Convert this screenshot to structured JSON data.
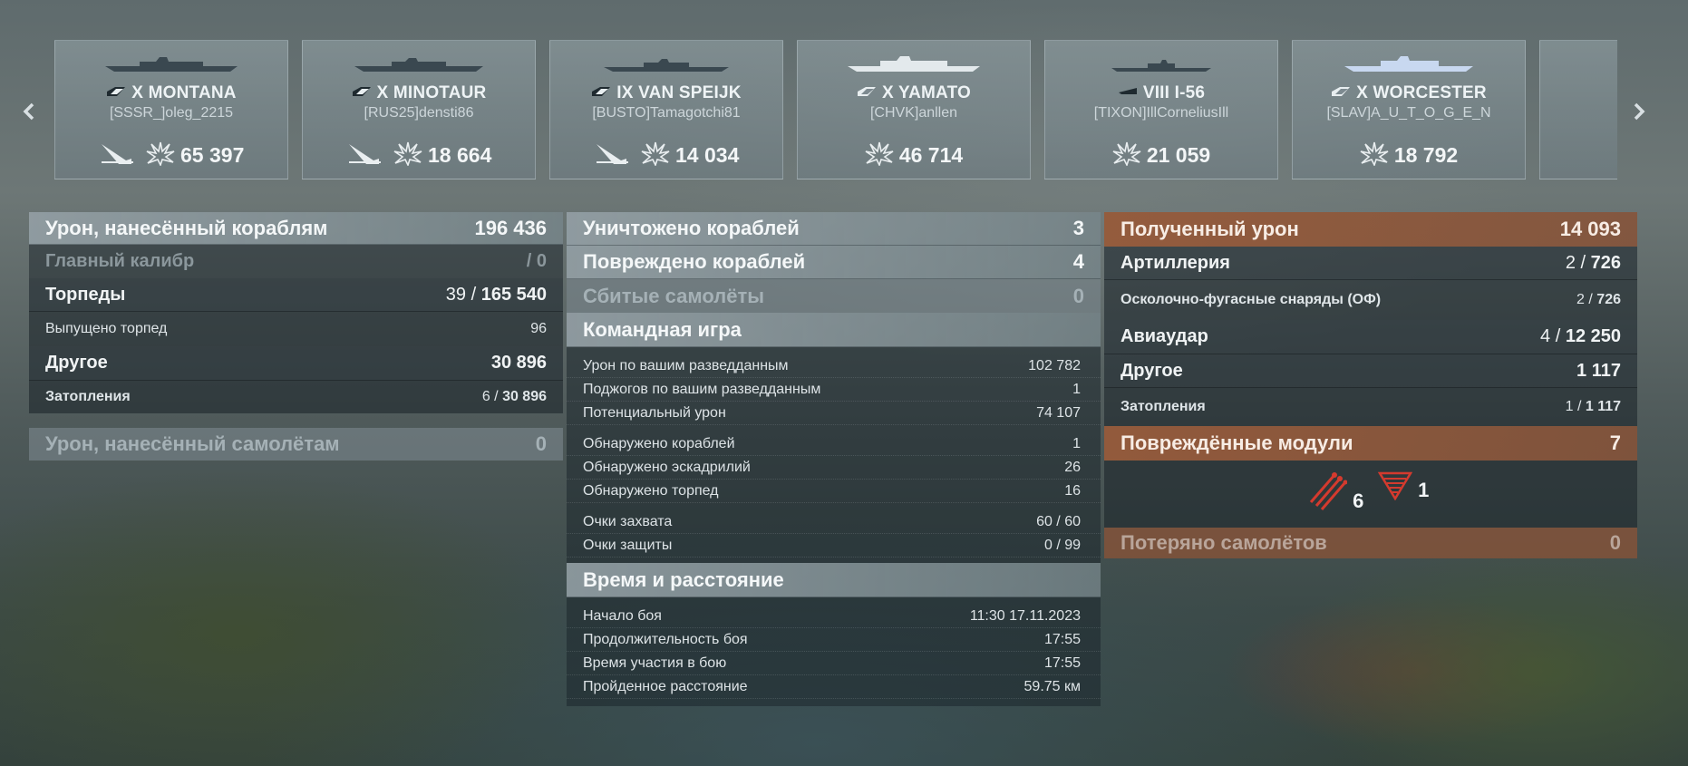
{
  "nav": {
    "left_icon": "chevron-left-icon",
    "right_icon": "chevron-right-icon"
  },
  "ships": [
    {
      "tier": "X",
      "name": "MONTANA",
      "player": "[SSSR_]oleg_2215",
      "sunk": true,
      "damage": "65 397"
    },
    {
      "tier": "X",
      "name": "MINOTAUR",
      "player": "[RUS25]densti86",
      "sunk": true,
      "damage": "18 664"
    },
    {
      "tier": "IX",
      "name": "VAN SPEIJK",
      "player": "[BUSTO]Tamagotchi81",
      "sunk": true,
      "damage": "14 034"
    },
    {
      "tier": "X",
      "name": "YAMATO",
      "player": "[CHVK]anllen",
      "sunk": false,
      "damage": "46 714"
    },
    {
      "tier": "VIII",
      "name": "I-56",
      "player": "[TIXON]IllCorneliusIll",
      "sunk": false,
      "damage": "21 059"
    },
    {
      "tier": "X",
      "name": "WORCESTER",
      "player": "[SLAV]A_U_T_O_G_E_N",
      "sunk": false,
      "damage": "18 792"
    }
  ],
  "damage_dealt": {
    "title": "Урон, нанесённый кораблям",
    "total": "196 436",
    "main_battery": {
      "label": "Главный калибр",
      "value": "/ 0"
    },
    "torpedoes": {
      "label": "Торпеды",
      "hits": "39 /",
      "damage": "165 540"
    },
    "torpedoes_fired": {
      "label": "Выпущено торпед",
      "value": "96"
    },
    "other": {
      "label": "Другое",
      "value": "30 896"
    },
    "flooding": {
      "label": "Затопления",
      "hits": "6 /",
      "damage": "30 896"
    },
    "aircraft": {
      "label": "Урон, нанесённый самолётам",
      "value": "0"
    }
  },
  "combat": {
    "destroyed": {
      "label": "Уничтожено кораблей",
      "value": "3"
    },
    "damaged": {
      "label": "Повреждено кораблей",
      "value": "4"
    },
    "planes_shot": {
      "label": "Сбитые самолёты",
      "value": "0"
    },
    "team_title": "Командная игра",
    "team_rows": [
      {
        "label": "Урон по вашим разведданным",
        "value": "102 782"
      },
      {
        "label": "Поджогов по вашим разведданным",
        "value": "1"
      },
      {
        "label": "Потенциальный урон",
        "value": "74 107"
      },
      {
        "label": "Обнаружено кораблей",
        "value": "1"
      },
      {
        "label": "Обнаружено эскадрилий",
        "value": "26"
      },
      {
        "label": "Обнаружено торпед",
        "value": "16"
      },
      {
        "label": "Очки захвата",
        "value": "60 / 60"
      },
      {
        "label": "Очки защиты",
        "value": "0 / 99"
      }
    ],
    "time_title": "Время и расстояние",
    "time_rows": [
      {
        "label": "Начало боя",
        "value": "11:30  17.11.2023"
      },
      {
        "label": "Продолжительность боя",
        "value": "17:55"
      },
      {
        "label": "Время участия в бою",
        "value": "17:55"
      },
      {
        "label": "Пройденное расстояние",
        "value": "59.75 км"
      }
    ]
  },
  "received": {
    "title": "Полученный урон",
    "total": "14 093",
    "artillery": {
      "label": "Артиллерия",
      "hits": "2 /",
      "damage": "726"
    },
    "he": {
      "label": "Осколочно-фугасные снаряды (ОФ)",
      "hits": "2 /",
      "damage": "726"
    },
    "airstrike": {
      "label": "Авиаудар",
      "hits": "4 /",
      "damage": "12 250"
    },
    "other": {
      "label": "Другое",
      "value": "1 117"
    },
    "flooding": {
      "label": "Затопления",
      "hits": "1 /",
      "damage": "1 117"
    },
    "modules_title": "Повреждённые модули",
    "modules_total": "7",
    "modules": [
      {
        "icon": "torpedo-tubes-icon",
        "count": "6"
      },
      {
        "icon": "rudder-icon",
        "count": "1"
      }
    ],
    "planes_lost": {
      "label": "Потеряно самолётов",
      "value": "0"
    }
  },
  "colors": {
    "accent_orange": "#8c5638",
    "torpedo_red": "#d43a2e"
  }
}
